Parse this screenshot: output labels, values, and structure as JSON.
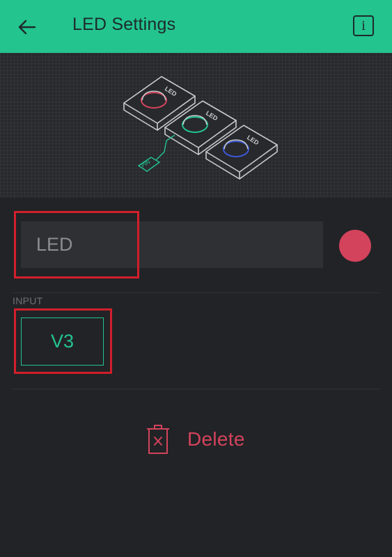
{
  "header": {
    "title": "LED Settings",
    "back_icon": "arrow-left-icon",
    "info_label": "i",
    "background_color": "#23c48e"
  },
  "illustration": {
    "led_labels": [
      "LED",
      "LED",
      "LED"
    ],
    "led_colors": [
      "#d3435c",
      "#23c48e",
      "#3f57d8"
    ],
    "pin_label": "PIN"
  },
  "name_field": {
    "value": "LED"
  },
  "color_picker": {
    "color": "#d3435c"
  },
  "input_section": {
    "label": "INPUT",
    "pin_value": "V3"
  },
  "delete_button": {
    "label": "Delete",
    "icon": "trash-icon",
    "color": "#d3435c"
  }
}
